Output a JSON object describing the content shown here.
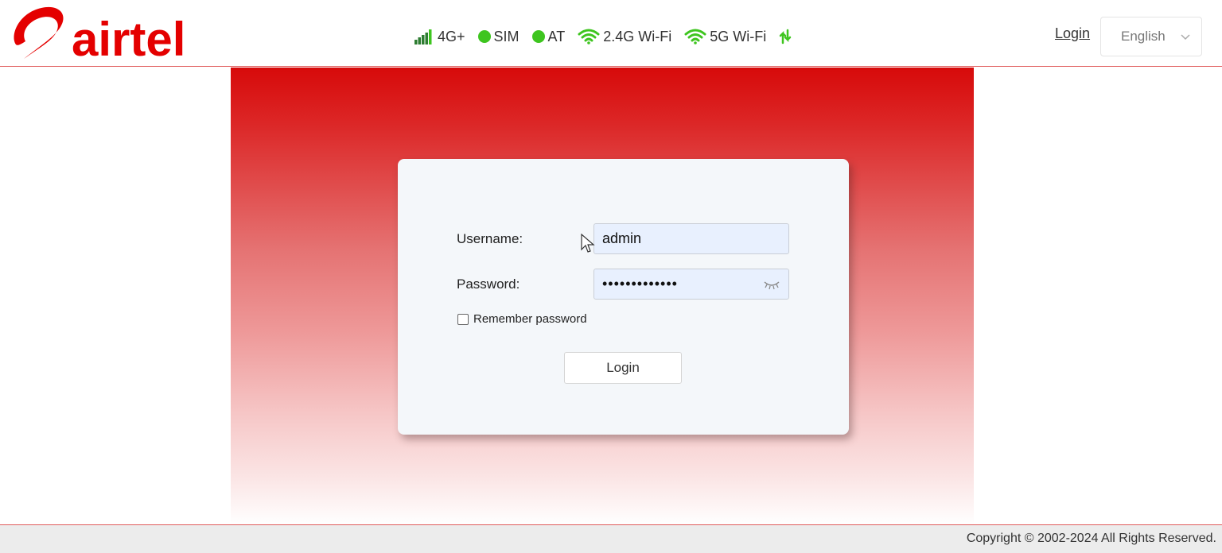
{
  "brand": {
    "name": "airtel",
    "color": "#e40000"
  },
  "status_bar": {
    "network": "4G+",
    "sim": "SIM",
    "at": "AT",
    "wifi_24": "2.4G Wi-Fi",
    "wifi_5": "5G Wi-Fi",
    "indicator_color": "#3ec51f"
  },
  "header": {
    "login_link": "Login",
    "language": "English"
  },
  "login_form": {
    "username_label": "Username:",
    "username_value": "admin",
    "password_label": "Password:",
    "password_value": "•••••••••••••",
    "remember_label": "Remember password",
    "login_button": "Login"
  },
  "footer": {
    "copyright": "Copyright © 2002-2024 All Rights Reserved."
  }
}
